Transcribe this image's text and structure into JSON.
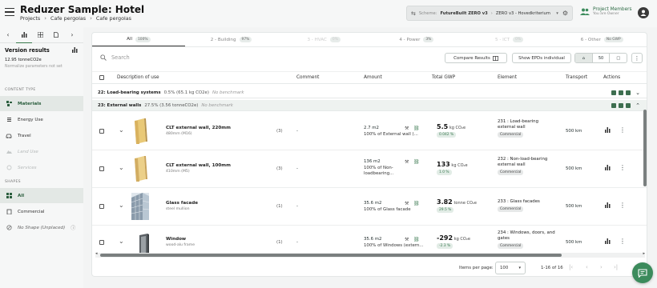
{
  "header": {
    "title": "Reduzer Sample: Hotel",
    "breadcrumb": [
      "Projects",
      "Cafe pergolas",
      "Cafe pergolas"
    ],
    "scheme_label": "Scheme:",
    "scheme_value": "FutureBuilt ZERO v3",
    "criterion_value": "ZERO v3 - Hovedkriterium",
    "members_title": "Project Members",
    "members_sub": "You are Owner"
  },
  "sidebar": {
    "version_title": "Version results",
    "version_value": "12.95 tonneCO2e",
    "normalize_text": "Normalize parameters not set",
    "content_type_label": "CONTENT TYPE",
    "content_items": [
      {
        "label": "Materials",
        "icon": "materials-icon",
        "active": true,
        "disabled": false
      },
      {
        "label": "Energy Use",
        "icon": "energy-icon",
        "active": false,
        "disabled": false
      },
      {
        "label": "Travel",
        "icon": "car-icon",
        "active": false,
        "disabled": false
      },
      {
        "label": "Land Use",
        "icon": "land-icon",
        "active": false,
        "disabled": true
      },
      {
        "label": "Services",
        "icon": "services-icon",
        "active": false,
        "disabled": true
      }
    ],
    "shapes_label": "SHAPES",
    "shape_items": [
      {
        "label": "All",
        "active": true
      },
      {
        "label": "Commercial",
        "active": false
      },
      {
        "label": "No Shape (Unplaced)",
        "active": false
      }
    ]
  },
  "tabs": [
    {
      "label": "All",
      "badge": "100%",
      "active": true,
      "disabled": false
    },
    {
      "label": "2 - Building",
      "badge": "97%",
      "active": false,
      "disabled": false
    },
    {
      "label": "3 - HVAC",
      "badge": "0%",
      "active": false,
      "disabled": true
    },
    {
      "label": "4 - Power",
      "badge": "3%",
      "active": false,
      "disabled": false
    },
    {
      "label": "5 - ICT",
      "badge": "0%",
      "active": false,
      "disabled": true
    },
    {
      "label": "6 - Other",
      "badge": "No GWP",
      "active": false,
      "disabled": false
    }
  ],
  "toolbar": {
    "search_placeholder": "Search",
    "compare_label": "Compare Results",
    "show_epd_label": "Show EPDs individual",
    "view_segments": [
      "⌂",
      "50",
      "□"
    ]
  },
  "columns": {
    "description": "Description of use",
    "comment": "Comment",
    "amount": "Amount",
    "gwp": "Total GWP",
    "element": "Element",
    "transport": "Transport",
    "actions": "Actions"
  },
  "groups": [
    {
      "code": "22: Load-bearing systems",
      "meta": "0.5% (65.1 kg CO2e)",
      "note": "No benchmark"
    },
    {
      "code": "23: External walls",
      "meta": "27.5% (3.56 tonneCO2e)",
      "note": "No benchmark"
    }
  ],
  "rows": [
    {
      "name": "CLT external wall, 220mm",
      "sub": "480mm (M16)",
      "count": "(3)",
      "comment": "-",
      "amount": "2.7 m2",
      "amount_sub": "100% of External wall (...",
      "gwp": "5.5",
      "gwp_unit": "kg CO₂e",
      "gwp_tag": "0.042 %",
      "element": "231 : Load-bearing external wall",
      "element_tag": "Commercial",
      "transport": "500 km",
      "thumb": "wall"
    },
    {
      "name": "CLT external wall, 100mm",
      "sub": "410mm (M5)",
      "count": "(3)",
      "comment": "-",
      "amount": "136 m2",
      "amount_sub": "100% of Non-loadbearing...",
      "gwp": "133",
      "gwp_unit": "kg CO₂e",
      "gwp_tag": "1.0 %",
      "element": "232 : Non-load-bearing external wall",
      "element_tag": "Commercial",
      "transport": "500 km",
      "thumb": "wall"
    },
    {
      "name": "Glass facade",
      "sub": "steel mullion",
      "count": "(1)",
      "comment": "-",
      "amount": "35.6 m2",
      "amount_sub": "100% of Glass facade",
      "gwp": "3.82",
      "gwp_unit": "tonne CO₂e",
      "gwp_tag": "29.5 %",
      "element": "233 : Glass facades",
      "element_tag": "Commercial",
      "transport": "500 km",
      "thumb": "glass"
    },
    {
      "name": "Window",
      "sub": "wood-alu frame",
      "count": "(1)",
      "comment": "-",
      "amount": "35.6 m2",
      "amount_sub": "100% of Windows (extern...",
      "gwp": "-292",
      "gwp_unit": "kg CO₂e",
      "gwp_tag": "-2.3 %",
      "element": "234 : Windows, doors, and gates",
      "element_tag": "Commercial",
      "transport": "500 km",
      "thumb": "window"
    }
  ],
  "pagination": {
    "items_label": "Items per page:",
    "per_page": "100",
    "range": "1-16 of 16"
  },
  "colors": {
    "accent": "#3c8b5c",
    "selected": "#e3e8e5"
  }
}
